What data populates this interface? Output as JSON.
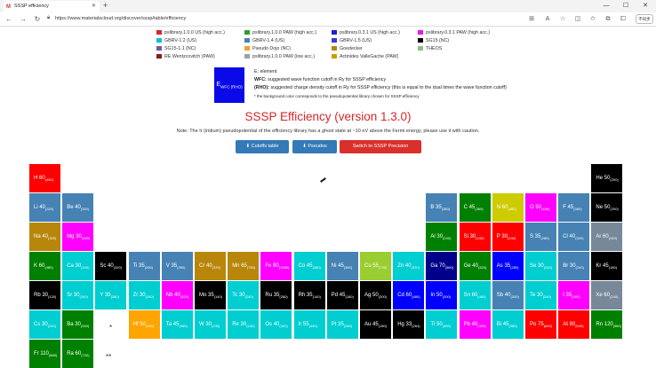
{
  "browser": {
    "tab_title": "SSSP efficiency",
    "url": "https://www.materialscloud.org/discover/sssp/table/efficiency",
    "profile_label": "不同步"
  },
  "legend": [
    {
      "label": "pslibrary.1.0.0 US (high acc.)",
      "color": "#d62728"
    },
    {
      "label": "pslibrary.1.0.0 PAW (high acc.)",
      "color": "#2ca02c"
    },
    {
      "label": "pslibrary.0.3.1 US (high acc.)",
      "color": "#1f1fcc"
    },
    {
      "label": "pslibrary.0.3.1 PAW (high acc.)",
      "color": "#e817e8"
    },
    {
      "label": "GBRV-1.2 (US)",
      "color": "#17becf"
    },
    {
      "label": "GBRV-1.4 (US)",
      "color": "#4682b4"
    },
    {
      "label": "GBRV-1.5 (US)",
      "color": "#3a3acc"
    },
    {
      "label": "SG15 (NC)",
      "color": "#000000"
    },
    {
      "label": "SG15-1.1 (NC)",
      "color": "#6b5ea8"
    },
    {
      "label": "Pseudo Dojo (NC)",
      "color": "#f0a030"
    },
    {
      "label": "Goedecker",
      "color": "#b8860b"
    },
    {
      "label": "THEOS",
      "color": "#8fbc8f"
    },
    {
      "label": "RE Wentzcovitch (PAW)",
      "color": "#8b1a1a"
    },
    {
      "label": "pslibrary.1.0.0 PAW (low acc.)",
      "color": "#9aa0b0"
    },
    {
      "label": "Actinides ValleGache (PAW)",
      "color": "#c8a000"
    }
  ],
  "info": {
    "box_label": "E",
    "box_sub": "WFC (RHO)",
    "line1": "E: element",
    "line2_bold": "WFC:",
    "line2": " suggested wave function cutoff in Ry for SSSP efficiency",
    "line3_bold": "(RHO):",
    "line3": " suggested charge density cutoff in Ry for SSSP efficiency (this is equal to the dual times the wave function cutoff)",
    "line4": "* the background color corresponds to the pseudopotential library chosen for SSSP efficiency"
  },
  "title": "SSSP Efficiency (version 1.3.0)",
  "note": "Note: The Ir (iridium) pseudopotential of the efficiency library has a ghost state at ~10 eV above the Fermi energy, please use it with caution.",
  "buttons": {
    "cutoffs": "Cutoffs table",
    "pseudos": "Pseudos",
    "precision": "Switch to SSSP Precision"
  },
  "gap_marks": {
    "lanthanides": "*",
    "actinides": "**"
  },
  "elements": [
    {
      "sym": "H",
      "wfc": "60",
      "rho": "480",
      "col": 1,
      "row": 1,
      "color": "#ff0000"
    },
    {
      "sym": "He",
      "wfc": "50",
      "rho": "200",
      "col": 18,
      "row": 1,
      "color": "#000000"
    },
    {
      "sym": "Li",
      "wfc": "40",
      "rho": "320",
      "col": 1,
      "row": 2,
      "color": "#4682b4"
    },
    {
      "sym": "Be",
      "wfc": "40",
      "rho": "320",
      "col": 2,
      "row": 2,
      "color": "#4682b4"
    },
    {
      "sym": "B",
      "wfc": "35",
      "rho": "280",
      "col": 13,
      "row": 2,
      "color": "#4682b4"
    },
    {
      "sym": "C",
      "wfc": "45",
      "rho": "360",
      "col": 14,
      "row": 2,
      "color": "#008000"
    },
    {
      "sym": "N",
      "wfc": "60",
      "rho": "480",
      "col": 15,
      "row": 2,
      "color": "#cccc00"
    },
    {
      "sym": "O",
      "wfc": "50",
      "rho": "400",
      "col": 16,
      "row": 2,
      "color": "#ff00ff"
    },
    {
      "sym": "F",
      "wfc": "45",
      "rho": "360",
      "col": 17,
      "row": 2,
      "color": "#4682b4"
    },
    {
      "sym": "Ne",
      "wfc": "50",
      "rho": "200",
      "col": 18,
      "row": 2,
      "color": "#000000"
    },
    {
      "sym": "Na",
      "wfc": "40",
      "rho": "320",
      "col": 1,
      "row": 3,
      "color": "#b8860b"
    },
    {
      "sym": "Mg",
      "wfc": "30",
      "rho": "240",
      "col": 2,
      "row": 3,
      "color": "#ff00ff"
    },
    {
      "sym": "Al",
      "wfc": "30",
      "rho": "240",
      "col": 13,
      "row": 3,
      "color": "#008000"
    },
    {
      "sym": "Si",
      "wfc": "30",
      "rho": "240",
      "col": 14,
      "row": 3,
      "color": "#ff0000"
    },
    {
      "sym": "P",
      "wfc": "30",
      "rho": "240",
      "col": 15,
      "row": 3,
      "color": "#ff0000"
    },
    {
      "sym": "S",
      "wfc": "35",
      "rho": "280",
      "col": 16,
      "row": 3,
      "color": "#4682b4"
    },
    {
      "sym": "Cl",
      "wfc": "40",
      "rho": "320",
      "col": 17,
      "row": 3,
      "color": "#4682b4"
    },
    {
      "sym": "Ar",
      "wfc": "60",
      "rho": "240",
      "col": 18,
      "row": 3,
      "color": "#778899"
    },
    {
      "sym": "K",
      "wfc": "60",
      "rho": "480",
      "col": 1,
      "row": 4,
      "color": "#008000"
    },
    {
      "sym": "Ca",
      "wfc": "30",
      "rho": "240",
      "col": 2,
      "row": 4,
      "color": "#00ced1"
    },
    {
      "sym": "Sc",
      "wfc": "40",
      "rho": "320",
      "col": 3,
      "row": 4,
      "color": "#000000"
    },
    {
      "sym": "Ti",
      "wfc": "35",
      "rho": "280",
      "col": 4,
      "row": 4,
      "color": "#4682b4"
    },
    {
      "sym": "V",
      "wfc": "35",
      "rho": "280",
      "col": 5,
      "row": 4,
      "color": "#4682b4"
    },
    {
      "sym": "Cr",
      "wfc": "40",
      "rho": "320",
      "col": 6,
      "row": 4,
      "color": "#b8860b"
    },
    {
      "sym": "Mn",
      "wfc": "65",
      "rho": "780",
      "col": 7,
      "row": 4,
      "color": "#b8860b"
    },
    {
      "sym": "Fe",
      "wfc": "90",
      "rho": "1080",
      "col": 8,
      "row": 4,
      "color": "#ff00ff"
    },
    {
      "sym": "Co",
      "wfc": "45",
      "rho": "360",
      "col": 9,
      "row": 4,
      "color": "#00ced1"
    },
    {
      "sym": "Ni",
      "wfc": "45",
      "rho": "360",
      "col": 10,
      "row": 4,
      "color": "#4682b4"
    },
    {
      "sym": "Cu",
      "wfc": "55",
      "rho": "720",
      "col": 11,
      "row": 4,
      "color": "#9acd32"
    },
    {
      "sym": "Zn",
      "wfc": "40",
      "rho": "320",
      "col": 12,
      "row": 4,
      "color": "#00ced1"
    },
    {
      "sym": "Ga",
      "wfc": "70",
      "rho": "560",
      "col": 13,
      "row": 4,
      "color": "#00008b"
    },
    {
      "sym": "Ge",
      "wfc": "40",
      "rho": "320",
      "col": 14,
      "row": 4,
      "color": "#008000"
    },
    {
      "sym": "As",
      "wfc": "35",
      "rho": "280",
      "col": 15,
      "row": 4,
      "color": "#0000ff"
    },
    {
      "sym": "Se",
      "wfc": "30",
      "rho": "240",
      "col": 16,
      "row": 4,
      "color": "#00ced1"
    },
    {
      "sym": "Br",
      "wfc": "30",
      "rho": "240",
      "col": 17,
      "row": 4,
      "color": "#4682b4"
    },
    {
      "sym": "Kr",
      "wfc": "45",
      "rho": "180",
      "col": 18,
      "row": 4,
      "color": "#000000"
    },
    {
      "sym": "Rb",
      "wfc": "30",
      "rho": "120",
      "col": 1,
      "row": 5,
      "color": "#000000"
    },
    {
      "sym": "Sr",
      "wfc": "30",
      "rho": "240",
      "col": 2,
      "row": 5,
      "color": "#00ced1"
    },
    {
      "sym": "Y",
      "wfc": "35",
      "rho": "280",
      "col": 3,
      "row": 5,
      "color": "#00ced1"
    },
    {
      "sym": "Zr",
      "wfc": "30",
      "rho": "240",
      "col": 4,
      "row": 5,
      "color": "#00ced1"
    },
    {
      "sym": "Nb",
      "wfc": "40",
      "rho": "320",
      "col": 5,
      "row": 5,
      "color": "#ff00ff"
    },
    {
      "sym": "Mo",
      "wfc": "35",
      "rho": "140",
      "col": 6,
      "row": 5,
      "color": "#000000"
    },
    {
      "sym": "Tc",
      "wfc": "30",
      "rho": "240",
      "col": 7,
      "row": 5,
      "color": "#00ced1"
    },
    {
      "sym": "Ru",
      "wfc": "35",
      "rho": "280",
      "col": 8,
      "row": 5,
      "color": "#000000"
    },
    {
      "sym": "Rh",
      "wfc": "35",
      "rho": "140",
      "col": 9,
      "row": 5,
      "color": "#000000"
    },
    {
      "sym": "Pd",
      "wfc": "45",
      "rho": "180",
      "col": 10,
      "row": 5,
      "color": "#000000"
    },
    {
      "sym": "Ag",
      "wfc": "50",
      "rho": "200",
      "col": 11,
      "row": 5,
      "color": "#000000"
    },
    {
      "sym": "Cd",
      "wfc": "60",
      "rho": "480",
      "col": 12,
      "row": 5,
      "color": "#0000ff"
    },
    {
      "sym": "In",
      "wfc": "50",
      "rho": "200",
      "col": 13,
      "row": 5,
      "color": "#0000ff"
    },
    {
      "sym": "Sn",
      "wfc": "60",
      "rho": "480",
      "col": 14,
      "row": 5,
      "color": "#00ced1"
    },
    {
      "sym": "Sb",
      "wfc": "40",
      "rho": "320",
      "col": 15,
      "row": 5,
      "color": "#4682b4"
    },
    {
      "sym": "Te",
      "wfc": "30",
      "rho": "240",
      "col": 16,
      "row": 5,
      "color": "#00ced1"
    },
    {
      "sym": "I",
      "wfc": "35",
      "rho": "280",
      "col": 17,
      "row": 5,
      "color": "#ff00ff"
    },
    {
      "sym": "Xe",
      "wfc": "60",
      "rho": "240",
      "col": 18,
      "row": 5,
      "color": "#778899"
    },
    {
      "sym": "Cs",
      "wfc": "30",
      "rho": "240",
      "col": 1,
      "row": 6,
      "color": "#00ced1"
    },
    {
      "sym": "Ba",
      "wfc": "30",
      "rho": "240",
      "col": 2,
      "row": 6,
      "color": "#008000"
    },
    {
      "sym": "Hf",
      "wfc": "50",
      "rho": "200",
      "col": 4,
      "row": 6,
      "color": "#ffa500"
    },
    {
      "sym": "Ta",
      "wfc": "45",
      "rho": "360",
      "col": 5,
      "row": 6,
      "color": "#00ced1"
    },
    {
      "sym": "W",
      "wfc": "30",
      "rho": "240",
      "col": 6,
      "row": 6,
      "color": "#00ced1"
    },
    {
      "sym": "Re",
      "wfc": "30",
      "rho": "240",
      "col": 7,
      "row": 6,
      "color": "#00ced1"
    },
    {
      "sym": "Os",
      "wfc": "40",
      "rho": "320",
      "col": 8,
      "row": 6,
      "color": "#00ced1"
    },
    {
      "sym": "Ir",
      "wfc": "55",
      "rho": "440",
      "col": 9,
      "row": 6,
      "color": "#00ced1"
    },
    {
      "sym": "Pt",
      "wfc": "35",
      "rho": "280",
      "col": 10,
      "row": 6,
      "color": "#00ced1"
    },
    {
      "sym": "Au",
      "wfc": "45",
      "rho": "180",
      "col": 11,
      "row": 6,
      "color": "#000000"
    },
    {
      "sym": "Hg",
      "wfc": "33",
      "rho": "264",
      "col": 12,
      "row": 6,
      "color": "#000000"
    },
    {
      "sym": "Tl",
      "wfc": "50",
      "rho": "400",
      "col": 13,
      "row": 6,
      "color": "#00ced1"
    },
    {
      "sym": "Pb",
      "wfc": "40",
      "rho": "320",
      "col": 14,
      "row": 6,
      "color": "#ff00ff"
    },
    {
      "sym": "Bi",
      "wfc": "45",
      "rho": "360",
      "col": 15,
      "row": 6,
      "color": "#00ced1"
    },
    {
      "sym": "Po",
      "wfc": "75",
      "rho": "600",
      "col": 16,
      "row": 6,
      "color": "#ff0000"
    },
    {
      "sym": "At",
      "wfc": "80",
      "rho": "640",
      "col": 17,
      "row": 6,
      "color": "#ff0000"
    },
    {
      "sym": "Rn",
      "wfc": "120",
      "rho": "960",
      "col": 18,
      "row": 6,
      "color": "#008000"
    },
    {
      "sym": "Fr",
      "wfc": "110",
      "rho": "880",
      "col": 1,
      "row": 7,
      "color": "#008000"
    },
    {
      "sym": "Ra",
      "wfc": "60",
      "rho": "720",
      "col": 2,
      "row": 7,
      "color": "#008000"
    }
  ]
}
